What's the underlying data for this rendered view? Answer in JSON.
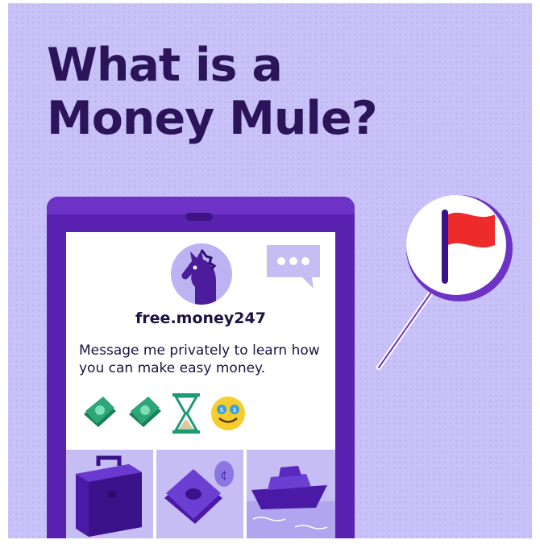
{
  "headline": {
    "line1": "What is a",
    "line2": "Money Mule?"
  },
  "post": {
    "username": "free.money247",
    "message": "Message me privately to learn how you can make easy money."
  },
  "icons": {
    "avatar": "horse-icon",
    "chat": "chat-bubble-icon",
    "money_1": "cash-icon",
    "money_2": "cash-icon",
    "hourglass": "hourglass-icon",
    "smiley": "money-eyes-smiley-icon",
    "tile_1": "briefcase-icon",
    "tile_2": "cash-coin-icon",
    "tile_3": "yacht-icon",
    "flag": "red-flag-icon"
  },
  "colors": {
    "background": "#c9c2f8",
    "headline": "#2b1459",
    "phone": "#5a22b0",
    "flag": "#ee2b2b",
    "money": "#1f9a6a",
    "smiley": "#f7cd2e"
  }
}
